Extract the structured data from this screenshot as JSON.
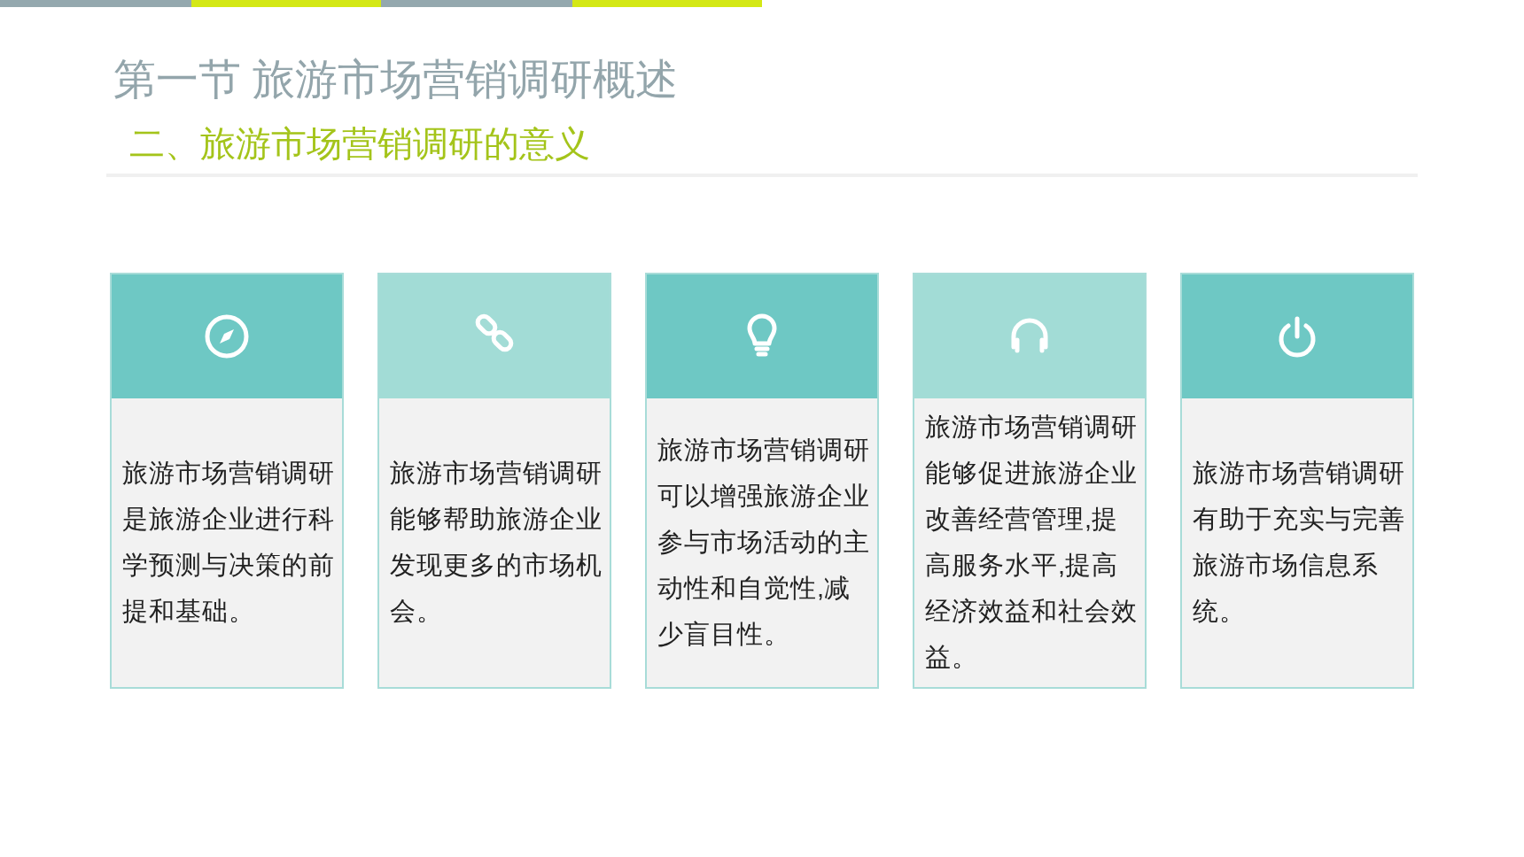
{
  "title": "第一节 旅游市场营销调研概述",
  "subtitle": "二、旅游市场营销调研的意义",
  "cards": [
    {
      "color": "#6ec8c4",
      "text": "旅游市场营销调研是旅游企业进行科学预测与决策的前提和基础。"
    },
    {
      "color": "#a2dcd6",
      "text": "旅游市场营销调研能够帮助旅游企业发现更多的市场机会。"
    },
    {
      "color": "#6ec8c4",
      "text": "旅游市场营销调研可以增强旅游企业参与市场活动的主动性和自觉性,减少盲目性。"
    },
    {
      "color": "#a2dcd6",
      "text": "旅游市场营销调研能够促进旅游企业改善经营管理,提高服务水平,提高经济效益和社会效益。"
    },
    {
      "color": "#6ec8c4",
      "text": "旅游市场营销调研有助于充实与完善旅游市场信息系统。"
    }
  ]
}
